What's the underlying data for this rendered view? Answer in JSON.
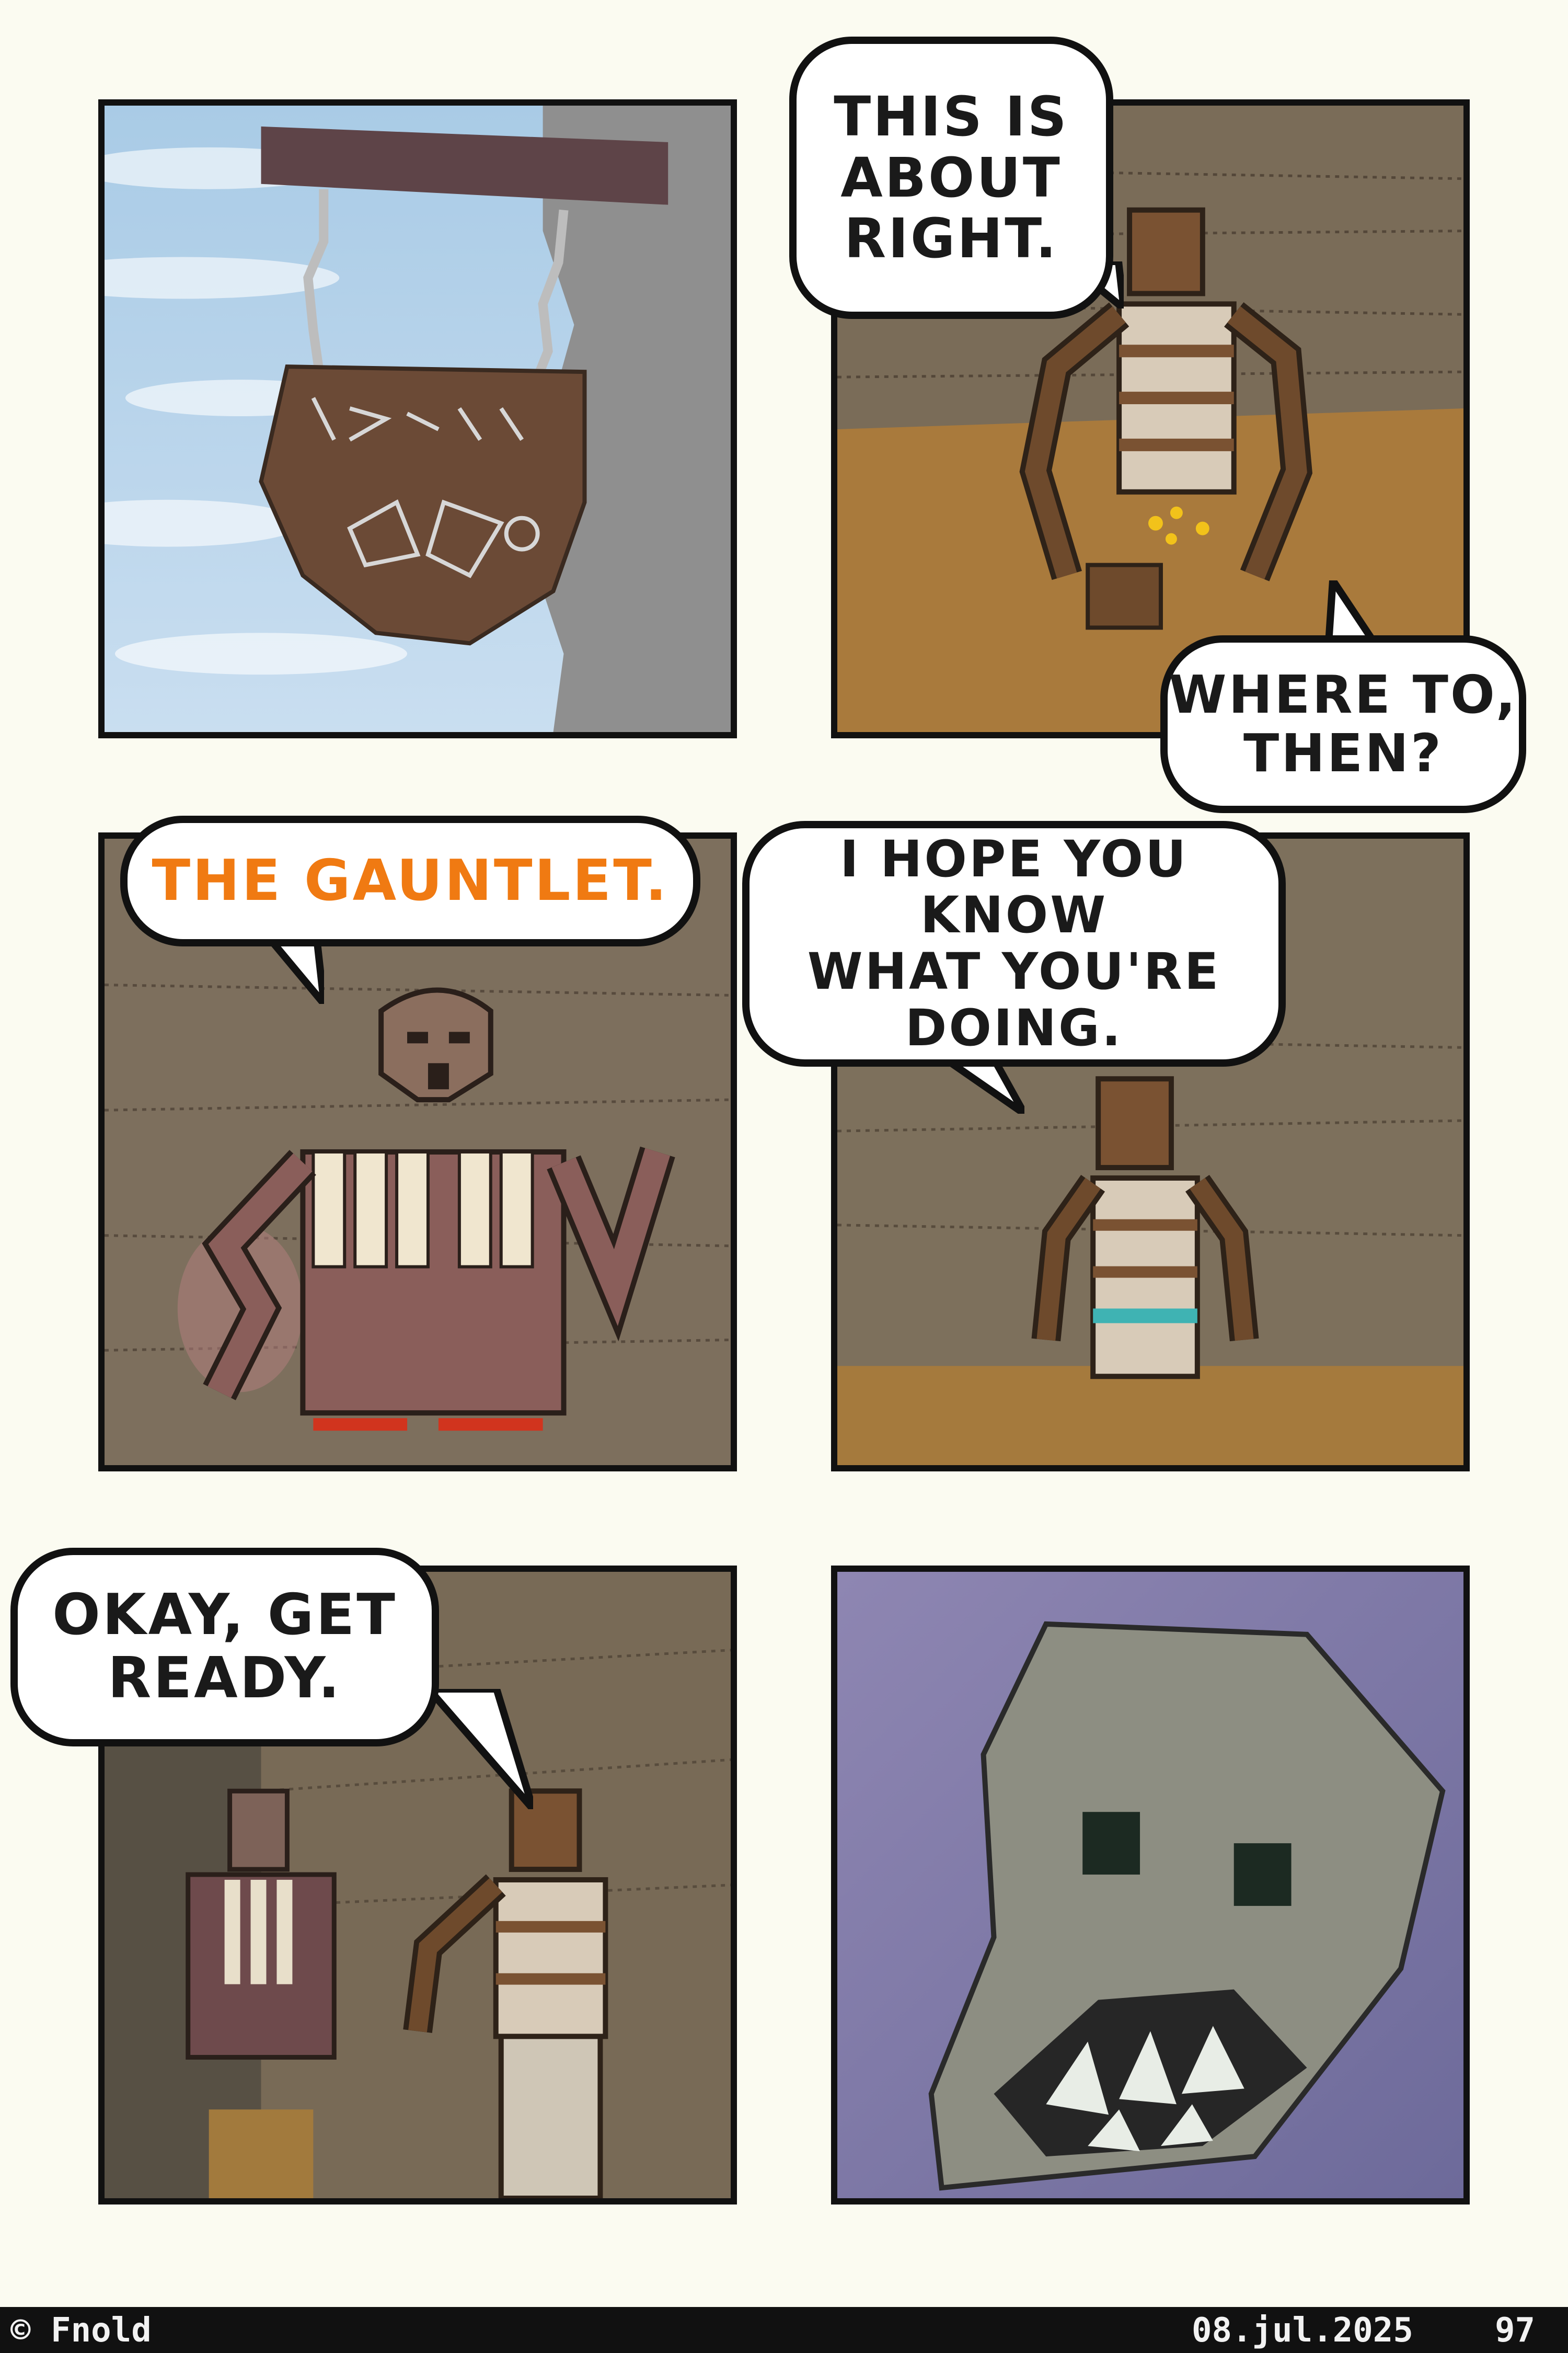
{
  "panels": {
    "p2_line1": "THIS IS\nABOUT\nRIGHT.",
    "p2_line2": "WHERE TO,\nTHEN?",
    "p3_line": "THE GAUNTLET.",
    "p4_line": "I HOPE YOU KNOW\nWHAT YOU'RE\nDOING.",
    "p5_line": "OKAY, GET\nREADY."
  },
  "footer": {
    "copyright": "© Fnold",
    "date": "08.jul.2025",
    "page_number": "97"
  },
  "colors": {
    "orange_speech": "#f07a12",
    "dark_speech": "#1a1a1a"
  }
}
